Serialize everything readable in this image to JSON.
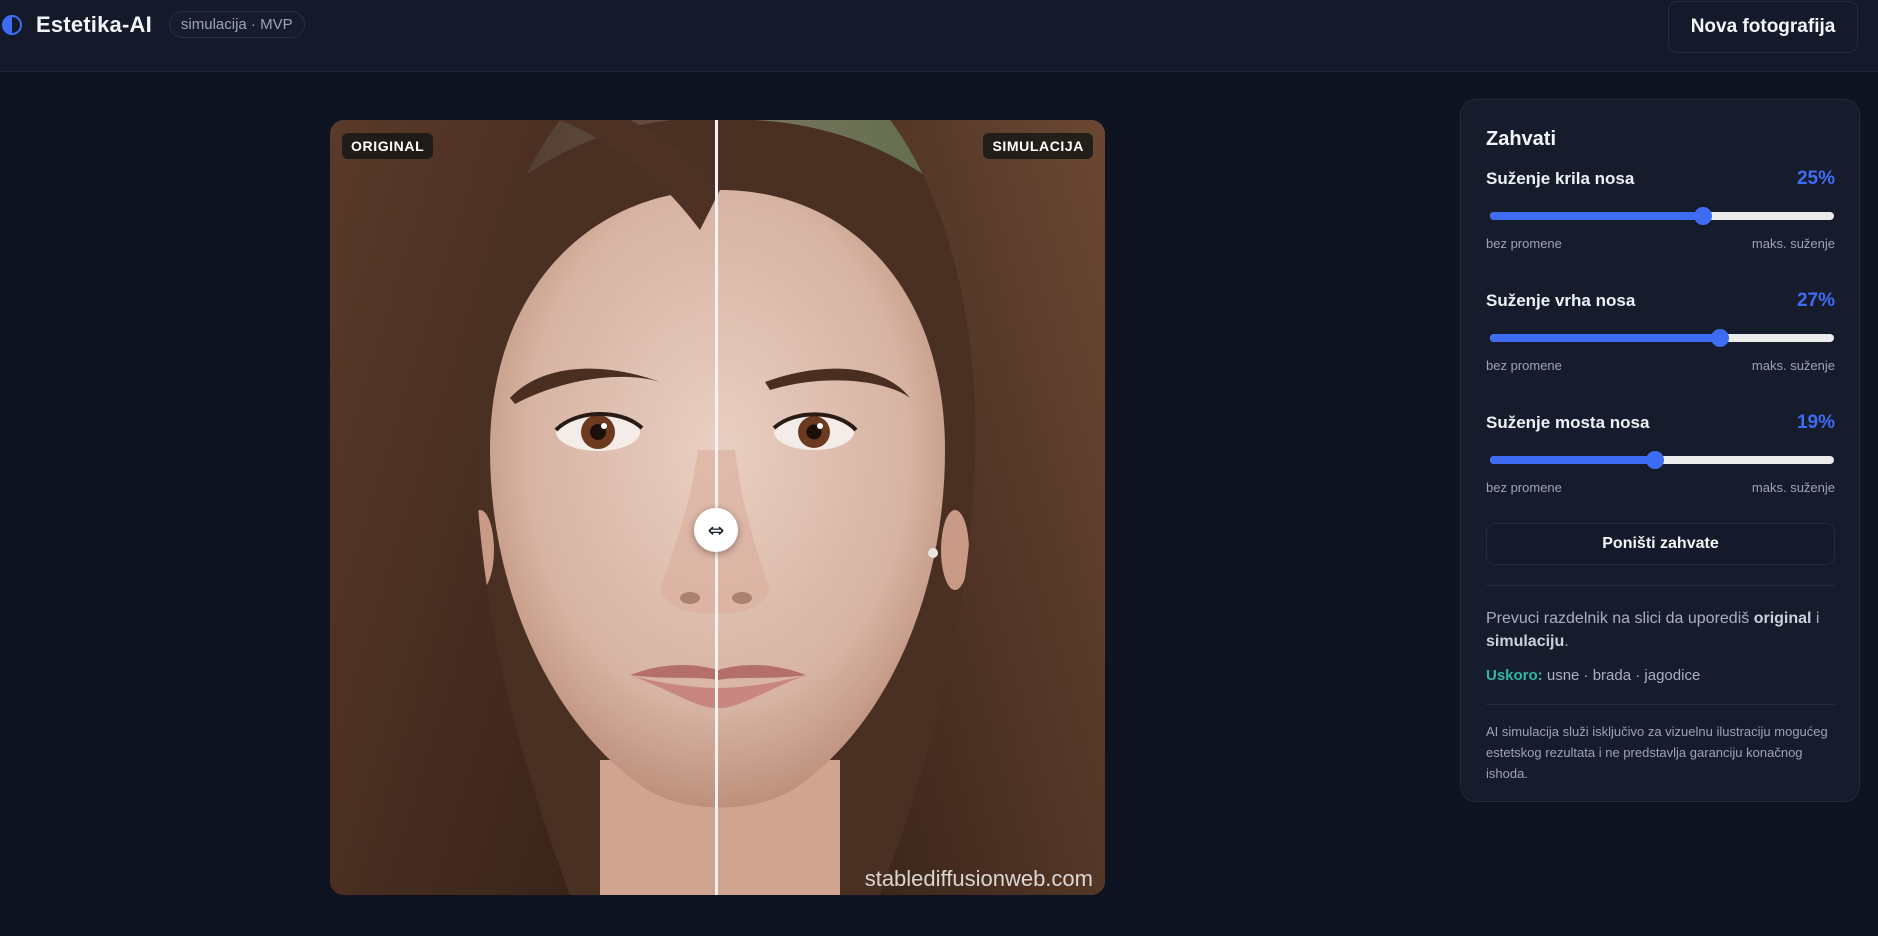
{
  "header": {
    "app_name": "Estetika-AI",
    "mode_badge": "simulacija · MVP",
    "new_photo_label": "Nova fotografija"
  },
  "viewer": {
    "left_label": "ORIGINAL",
    "right_label": "SIMULACIJA",
    "watermark": "stablediffusionweb.com",
    "divider_position": 0.5,
    "handle_glyph": "⇔"
  },
  "panel": {
    "title": "Zahvati",
    "sliders": [
      {
        "label": "Suženje krila nosa",
        "value": "25%",
        "fraction": 0.62,
        "min_label": "bez promene",
        "max_label": "maks. suženje"
      },
      {
        "label": "Suženje vrha nosa",
        "value": "27%",
        "fraction": 0.67,
        "min_label": "bez promene",
        "max_label": "maks. suženje"
      },
      {
        "label": "Suženje mosta nosa",
        "value": "19%",
        "fraction": 0.48,
        "min_label": "bez promene",
        "max_label": "maks. suženje"
      }
    ],
    "reset_label": "Poništi zahvate",
    "hint_prefix": "Prevuci razdelnik na slici da uporediš ",
    "hint_original": "original",
    "hint_mid": " i ",
    "hint_simulation": "simulaciju",
    "hint_suffix": ".",
    "soon_label": "Uskoro:",
    "soon_items": " usne · brada · jagodice",
    "disclaimer": "AI simulacija služi isključivo za vizuelnu ilustraciju mogućeg estetskog rezultata i ne predstavlja garanciju konačnog ishoda."
  },
  "colors": {
    "accent": "#3f6cf4",
    "soon": "#2fb8a6",
    "background": "#0f1422"
  },
  "icons": {
    "brand": "half-circle-icon",
    "divider_handle": "horizontal-arrows-icon"
  }
}
